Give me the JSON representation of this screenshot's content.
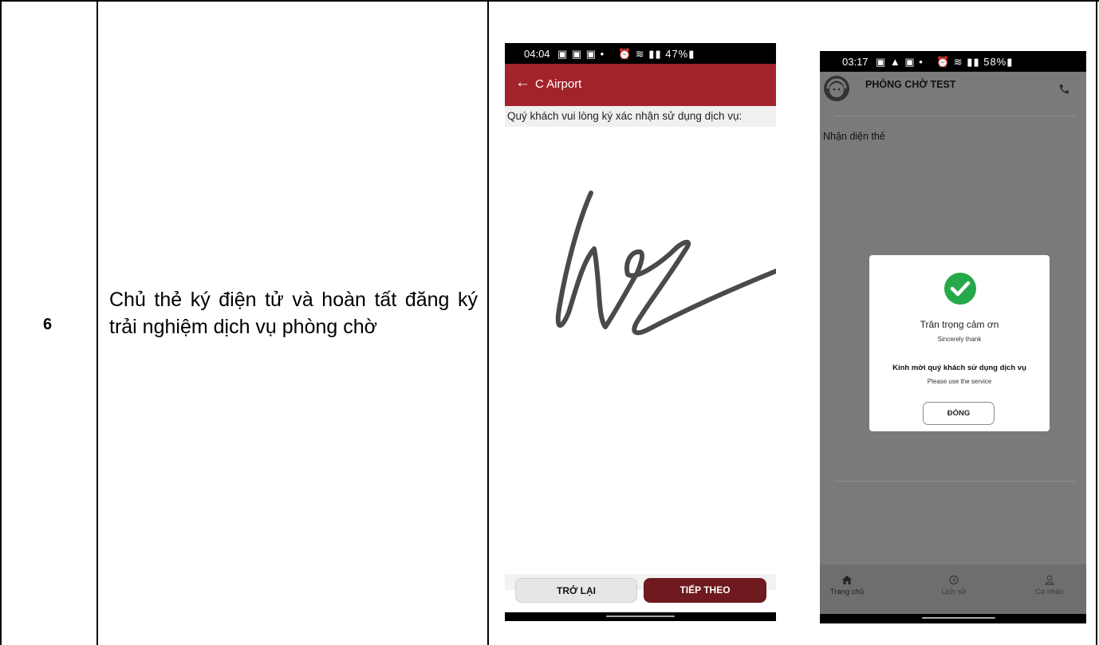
{
  "row": {
    "step_number": "6",
    "description": "Chủ thẻ ký điện tử và hoàn tất đăng ký trải nghiệm dịch vụ phòng chờ"
  },
  "screen1": {
    "status_time": "04:04",
    "status_icons": "▣ ▣ ▣ •",
    "status_right": "⏰ ≋ ▮▮ 47%▮",
    "title": "C Airport",
    "instruction": "Quý khách vui lòng ký xác nhận sử dụng dịch vụ:",
    "back_button": "TRỞ LẠI",
    "next_button": "TIẾP THEO",
    "colors": {
      "appbar": "#a3232b",
      "next": "#6e1a1e"
    }
  },
  "screen2": {
    "status_time": "03:17",
    "status_icons": "▣ ▲ ▣ •",
    "status_right": "⏰ ≋ ▮▮ 58%▮",
    "room_name": "PHÒNG CHỜ TEST",
    "card_label": "Nhận diện thẻ",
    "dialog": {
      "title": "Trân trọng cảm ơn",
      "title_en": "Sincerely thank",
      "message": "Kính mời quý khách sử dụng dịch vụ",
      "message_en": "Please use the service",
      "close_button": "ĐÓNG"
    },
    "tabs": [
      {
        "label": "Trang chủ",
        "icon": "home-icon"
      },
      {
        "label": "Lịch sử",
        "icon": "history-icon"
      },
      {
        "label": "Cá nhân",
        "icon": "person-icon"
      }
    ],
    "colors": {
      "check": "#26a94a"
    }
  }
}
